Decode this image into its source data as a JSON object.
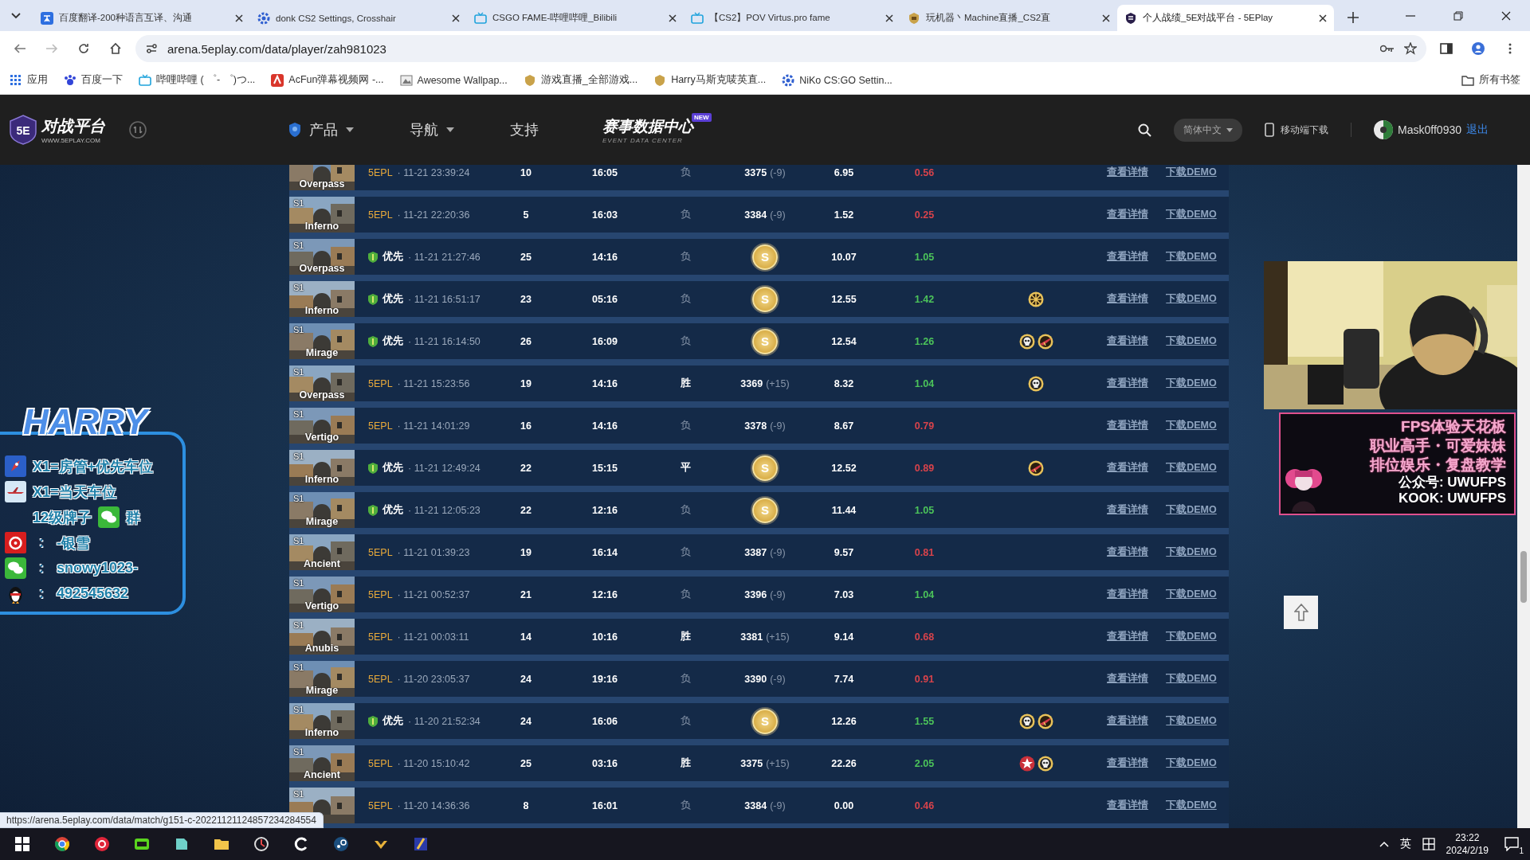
{
  "browser": {
    "tabs": [
      {
        "title": "百度翻译-200种语言互译、沟通",
        "selected": false
      },
      {
        "title": "donk CS2 Settings, Crosshair",
        "selected": false
      },
      {
        "title": "CSGO FAME-哔哩哔哩_Bilibili",
        "selected": false
      },
      {
        "title": "【CS2】POV Virtus.pro fame",
        "selected": false
      },
      {
        "title": "玩机器丶Machine直播_CS2直",
        "selected": false
      },
      {
        "title": "个人战绩_5E对战平台 - 5EPlay",
        "selected": true
      }
    ],
    "address": "arena.5eplay.com/data/player/zah981023",
    "bookmarks": [
      {
        "label": "应用"
      },
      {
        "label": "百度一下"
      },
      {
        "label": "哔哩哔哩 ( ゜- ゜)つ..."
      },
      {
        "label": "AcFun弹幕视频网 -..."
      },
      {
        "label": "Awesome Wallpap..."
      },
      {
        "label": "游戏直播_全部游戏..."
      },
      {
        "label": "Harry马斯克唛英直..."
      },
      {
        "label": "NiKo CS:GO Settin..."
      }
    ],
    "all_bookmarks": "所有书签"
  },
  "site_header": {
    "logo": {
      "mark": "5E",
      "title": "对战平台",
      "url": "WWW.5EPLAY.COM"
    },
    "nav": [
      {
        "label": "产品",
        "dropdown": true
      },
      {
        "label": "导航",
        "dropdown": true
      },
      {
        "label": "支持",
        "dropdown": false
      }
    ],
    "data_center": {
      "label": "赛事数据中心",
      "subtitle": "EVENT DATA CENTER",
      "badge": "NEW"
    },
    "language": "简体中文",
    "mobile": "移动端下载",
    "user": "Mask0ff0930",
    "logout": "退出"
  },
  "matches": [
    {
      "kind": "ranked",
      "map": "Overpass",
      "queue_label": "5EPL",
      "time": "· 11-21 23:39:24",
      "column_3": "10",
      "duration": "16:05",
      "result": "负",
      "result_bold": false,
      "elo": "3375",
      "elo_change": "(-9)",
      "rating": "6.95",
      "rws": "0.56",
      "rws_positive": false,
      "details": "查看详情",
      "demo": "下载DEMO"
    },
    {
      "kind": "ranked",
      "season": "S1",
      "map": "Inferno",
      "queue_label": "5EPL",
      "time": "· 11-21 22:20:36",
      "column_3": "5",
      "duration": "16:03",
      "result": "负",
      "result_bold": false,
      "elo": "3384",
      "elo_change": "(-9)",
      "rating": "1.52",
      "rws": "0.25",
      "rws_positive": false,
      "details": "查看详情",
      "demo": "下载DEMO"
    },
    {
      "kind": "priority",
      "season": "S1",
      "map": "Overpass",
      "queue_label": "优先",
      "time": "· 11-21 21:27:46",
      "column_3": "25",
      "duration": "14:16",
      "result": "负",
      "result_bold": false,
      "medal": "S",
      "rating": "10.07",
      "rws": "1.05",
      "rws_positive": true,
      "details": "查看详情",
      "demo": "下载DEMO"
    },
    {
      "kind": "priority",
      "season": "S1",
      "map": "Inferno",
      "queue_label": "优先",
      "time": "· 11-21 16:51:17",
      "column_3": "23",
      "duration": "05:16",
      "result": "负",
      "result_bold": false,
      "medal": "S",
      "rating": "12.55",
      "rws": "1.42",
      "rws_positive": true,
      "badges": [
        {
          "kind": "wheel"
        }
      ],
      "details": "查看详情",
      "demo": "下载DEMO"
    },
    {
      "kind": "priority",
      "season": "S1",
      "map": "Mirage",
      "queue_label": "优先",
      "time": "· 11-21 16:14:50",
      "column_3": "26",
      "duration": "16:09",
      "result": "负",
      "result_bold": false,
      "medal": "S",
      "rating": "12.54",
      "rws": "1.26",
      "rws_positive": true,
      "badges": [
        {
          "kind": "skull"
        },
        {
          "kind": "rifle"
        }
      ],
      "details": "查看详情",
      "demo": "下载DEMO"
    },
    {
      "kind": "ranked",
      "season": "S1",
      "map": "Overpass",
      "queue_label": "5EPL",
      "time": "· 11-21 15:23:56",
      "column_3": "19",
      "duration": "14:16",
      "result": "胜",
      "result_bold": true,
      "elo": "3369",
      "elo_change": "(+15)",
      "rating": "8.32",
      "rws": "1.04",
      "rws_positive": true,
      "badges": [
        {
          "kind": "skull"
        }
      ],
      "details": "查看详情",
      "demo": "下载DEMO"
    },
    {
      "kind": "ranked",
      "season": "S1",
      "map": "Vertigo",
      "queue_label": "5EPL",
      "time": "· 11-21 14:01:29",
      "column_3": "16",
      "duration": "14:16",
      "result": "负",
      "result_bold": false,
      "elo": "3378",
      "elo_change": "(-9)",
      "rating": "8.67",
      "rws": "0.79",
      "rws_positive": false,
      "details": "查看详情",
      "demo": "下载DEMO"
    },
    {
      "kind": "priority",
      "season": "S1",
      "map": "Inferno",
      "queue_label": "优先",
      "time": "· 11-21 12:49:24",
      "column_3": "22",
      "duration": "15:15",
      "result": "平",
      "result_bold": true,
      "medal": "S",
      "rating": "12.52",
      "rws": "0.89",
      "rws_positive": false,
      "badges": [
        {
          "kind": "rifle"
        }
      ],
      "details": "查看详情",
      "demo": "下载DEMO"
    },
    {
      "kind": "priority",
      "season": "S1",
      "map": "Mirage",
      "queue_label": "优先",
      "time": "· 11-21 12:05:23",
      "column_3": "22",
      "duration": "12:16",
      "result": "负",
      "result_bold": false,
      "medal": "S",
      "rating": "11.44",
      "rws": "1.05",
      "rws_positive": true,
      "details": "查看详情",
      "demo": "下载DEMO"
    },
    {
      "kind": "ranked",
      "season": "S1",
      "map": "Ancient",
      "queue_label": "5EPL",
      "time": "· 11-21 01:39:23",
      "column_3": "19",
      "duration": "16:14",
      "result": "负",
      "result_bold": false,
      "elo": "3387",
      "elo_change": "(-9)",
      "rating": "9.57",
      "rws": "0.81",
      "rws_positive": false,
      "details": "查看详情",
      "demo": "下载DEMO"
    },
    {
      "kind": "ranked",
      "season": "S1",
      "map": "Vertigo",
      "queue_label": "5EPL",
      "time": "· 11-21 00:52:37",
      "column_3": "21",
      "duration": "12:16",
      "result": "负",
      "result_bold": false,
      "elo": "3396",
      "elo_change": "(-9)",
      "rating": "7.03",
      "rws": "1.04",
      "rws_positive": true,
      "details": "查看详情",
      "demo": "下载DEMO"
    },
    {
      "kind": "ranked",
      "season": "S1",
      "map": "Anubis",
      "queue_label": "5EPL",
      "time": "· 11-21 00:03:11",
      "column_3": "14",
      "duration": "10:16",
      "result": "胜",
      "result_bold": true,
      "elo": "3381",
      "elo_change": "(+15)",
      "rating": "9.14",
      "rws": "0.68",
      "rws_positive": false,
      "details": "查看详情",
      "demo": "下载DEMO"
    },
    {
      "kind": "ranked",
      "season": "S1",
      "map": "Mirage",
      "queue_label": "5EPL",
      "time": "· 11-20 23:05:37",
      "column_3": "24",
      "duration": "19:16",
      "result": "负",
      "result_bold": false,
      "elo": "3390",
      "elo_change": "(-9)",
      "rating": "7.74",
      "rws": "0.91",
      "rws_positive": false,
      "details": "查看详情",
      "demo": "下载DEMO"
    },
    {
      "kind": "priority",
      "season": "S1",
      "map": "Inferno",
      "queue_label": "优先",
      "time": "· 11-20 21:52:34",
      "column_3": "24",
      "duration": "16:06",
      "result": "负",
      "result_bold": false,
      "medal": "S",
      "rating": "12.26",
      "rws": "1.55",
      "rws_positive": true,
      "badges": [
        {
          "kind": "skull"
        },
        {
          "kind": "rifle"
        }
      ],
      "details": "查看详情",
      "demo": "下载DEMO"
    },
    {
      "kind": "ranked",
      "season": "S1",
      "map": "Ancient",
      "queue_label": "5EPL",
      "time": "· 11-20 15:10:42",
      "column_3": "25",
      "duration": "03:16",
      "result": "胜",
      "result_bold": true,
      "elo": "3375",
      "elo_change": "(+15)",
      "rating": "22.26",
      "rws": "2.05",
      "rws_positive": true,
      "badges": [
        {
          "kind": "star"
        },
        {
          "kind": "skull"
        }
      ],
      "details": "查看详情",
      "demo": "下载DEMO"
    },
    {
      "kind": "ranked",
      "season": "S1",
      "queue_label": "5EPL",
      "time": "· 11-20 14:36:36",
      "column_3": "8",
      "duration": "16:01",
      "result": "负",
      "result_bold": false,
      "elo": "3384",
      "elo_change": "(-9)",
      "rating": "0.00",
      "rws": "0.46",
      "rws_positive": false,
      "details": "查看详情",
      "demo": "下载DEMO"
    }
  ],
  "stream_overlay": {
    "title": "HARRY",
    "lines": [
      {
        "kind": "rocket",
        "text": "X1=房管+优先车位"
      },
      {
        "kind": "plane",
        "text": "X1=当天车位"
      },
      {
        "kind": "group",
        "text": "12级牌子",
        "suffix": "群"
      },
      {
        "kind": "music",
        "separator": ":",
        "text": "-银雪"
      },
      {
        "kind": "wechat",
        "separator": ":",
        "text": "snowy1023-"
      },
      {
        "kind": "penguin",
        "separator": ":",
        "text": "492545632"
      }
    ]
  },
  "promo": {
    "lines": [
      "FPS体验天花板",
      "职业高手・可爱妹妹",
      "排位娱乐・复盘教学",
      "公众号: UWUFPS",
      "KOOK: UWUFPS"
    ]
  },
  "status_url": "https://arena.5eplay.com/data/match/g151-c-20221121124857234284554",
  "taskbar": {
    "ime": "英",
    "time": "23:22",
    "date": "2024/2/19",
    "notifications": "1"
  }
}
